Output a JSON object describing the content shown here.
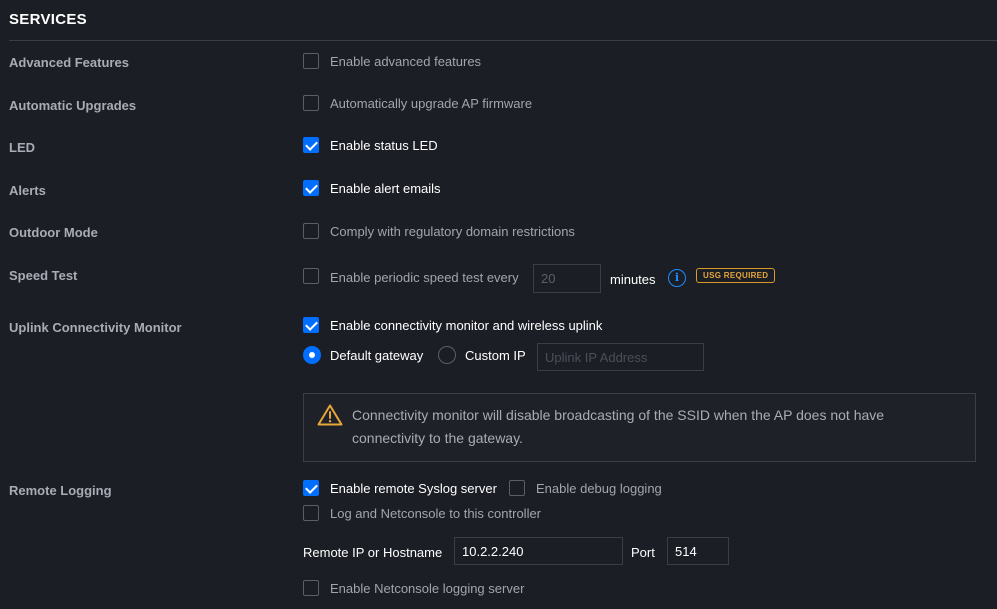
{
  "section": {
    "title": "SERVICES"
  },
  "rows": {
    "advanced": {
      "label": "Advanced Features",
      "option": "Enable advanced features",
      "checked": false
    },
    "upgrades": {
      "label": "Automatic Upgrades",
      "option": "Automatically upgrade AP firmware",
      "checked": false
    },
    "led": {
      "label": "LED",
      "option": "Enable status LED",
      "checked": true
    },
    "alerts": {
      "label": "Alerts",
      "option": "Enable alert emails",
      "checked": true
    },
    "outdoor": {
      "label": "Outdoor Mode",
      "option": "Comply with regulatory domain restrictions",
      "checked": false
    },
    "speedtest": {
      "label": "Speed Test",
      "option": "Enable periodic speed test every",
      "checked": false,
      "interval_value": "20",
      "unit": "minutes",
      "info_icon": "info-circle-icon",
      "badge": "USG REQUIRED"
    },
    "uplink": {
      "label": "Uplink Connectivity Monitor",
      "option": "Enable connectivity monitor and wireless uplink",
      "checked": true,
      "radio_default": "Default gateway",
      "radio_custom": "Custom IP",
      "selected_radio": "Default gateway",
      "uplink_ip_placeholder": "Uplink IP Address",
      "notice": "Connectivity monitor will disable broadcasting of the SSID when the AP does not have connectivity to the gateway.",
      "notice_icon": "warning-triangle-icon"
    },
    "logging": {
      "label": "Remote Logging",
      "syslog_option": "Enable remote Syslog server",
      "syslog_checked": true,
      "debug_option": "Enable debug logging",
      "debug_checked": false,
      "netconsole_controller_option": "Log and Netconsole to this controller",
      "netconsole_controller_checked": false,
      "host_label": "Remote IP or Hostname",
      "host_value": "10.2.2.240",
      "port_label": "Port",
      "port_value": "514",
      "netconsole_server_option": "Enable Netconsole logging server",
      "netconsole_server_checked": false
    }
  },
  "colors": {
    "background": "#1c1e26",
    "accent": "#006fff",
    "warning": "#e6a63a",
    "info": "#1a8cff"
  }
}
